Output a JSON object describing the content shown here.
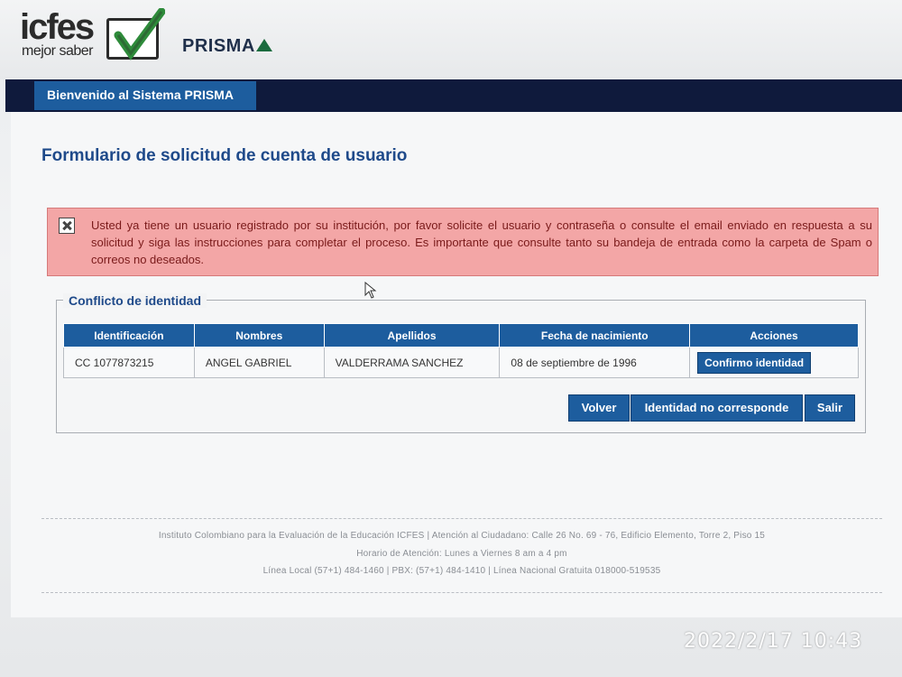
{
  "header": {
    "logo_main": "icfes",
    "logo_tagline": "mejor saber",
    "logo_product": "PRISMA"
  },
  "nav": {
    "welcome_tab": "Bienvenido al Sistema PRISMA"
  },
  "page": {
    "title": "Formulario de solicitud de cuenta de usuario"
  },
  "alert": {
    "icon": "close-icon",
    "message": "Usted ya tiene un usuario registrado por su institución, por favor solicite el usuario y contraseña o consulte el email enviado en respuesta a su solicitud y siga las instrucciones para completar el proceso. Es importante que consulte tanto su bandeja de entrada como la carpeta de Spam o correos no deseados."
  },
  "conflict": {
    "legend": "Conflicto de identidad",
    "columns": [
      "Identificación",
      "Nombres",
      "Apellidos",
      "Fecha de nacimiento",
      "Acciones"
    ],
    "rows": [
      {
        "identificacion": "CC 1077873215",
        "nombres": "ANGEL GABRIEL",
        "apellidos": "VALDERRAMA SANCHEZ",
        "fecha": "08 de septiembre de 1996",
        "accion": "Confirmo identidad"
      }
    ]
  },
  "buttons": {
    "back": "Volver",
    "not_match": "Identidad no corresponde",
    "exit": "Salir"
  },
  "footer": {
    "line1": "Instituto Colombiano para la Evaluación de la Educación ICFES  |  Atención al Ciudadano: Calle 26 No. 69 - 76, Edificio Elemento, Torre 2, Piso 15",
    "line2": "Horario de Atención: Lunes a Viernes 8 am a 4 pm",
    "line3": "Línea Local (57+1) 484-1460  |  PBX: (57+1) 484-1410  |  Línea Nacional Gratuita 018000-519535"
  },
  "photo_timestamp": "2022/2/17  10:43",
  "colors": {
    "primary": "#1d5d9e",
    "navbar": "#0f1a3c",
    "alert_bg": "#f3a6a6",
    "title": "#1f4a8a"
  }
}
